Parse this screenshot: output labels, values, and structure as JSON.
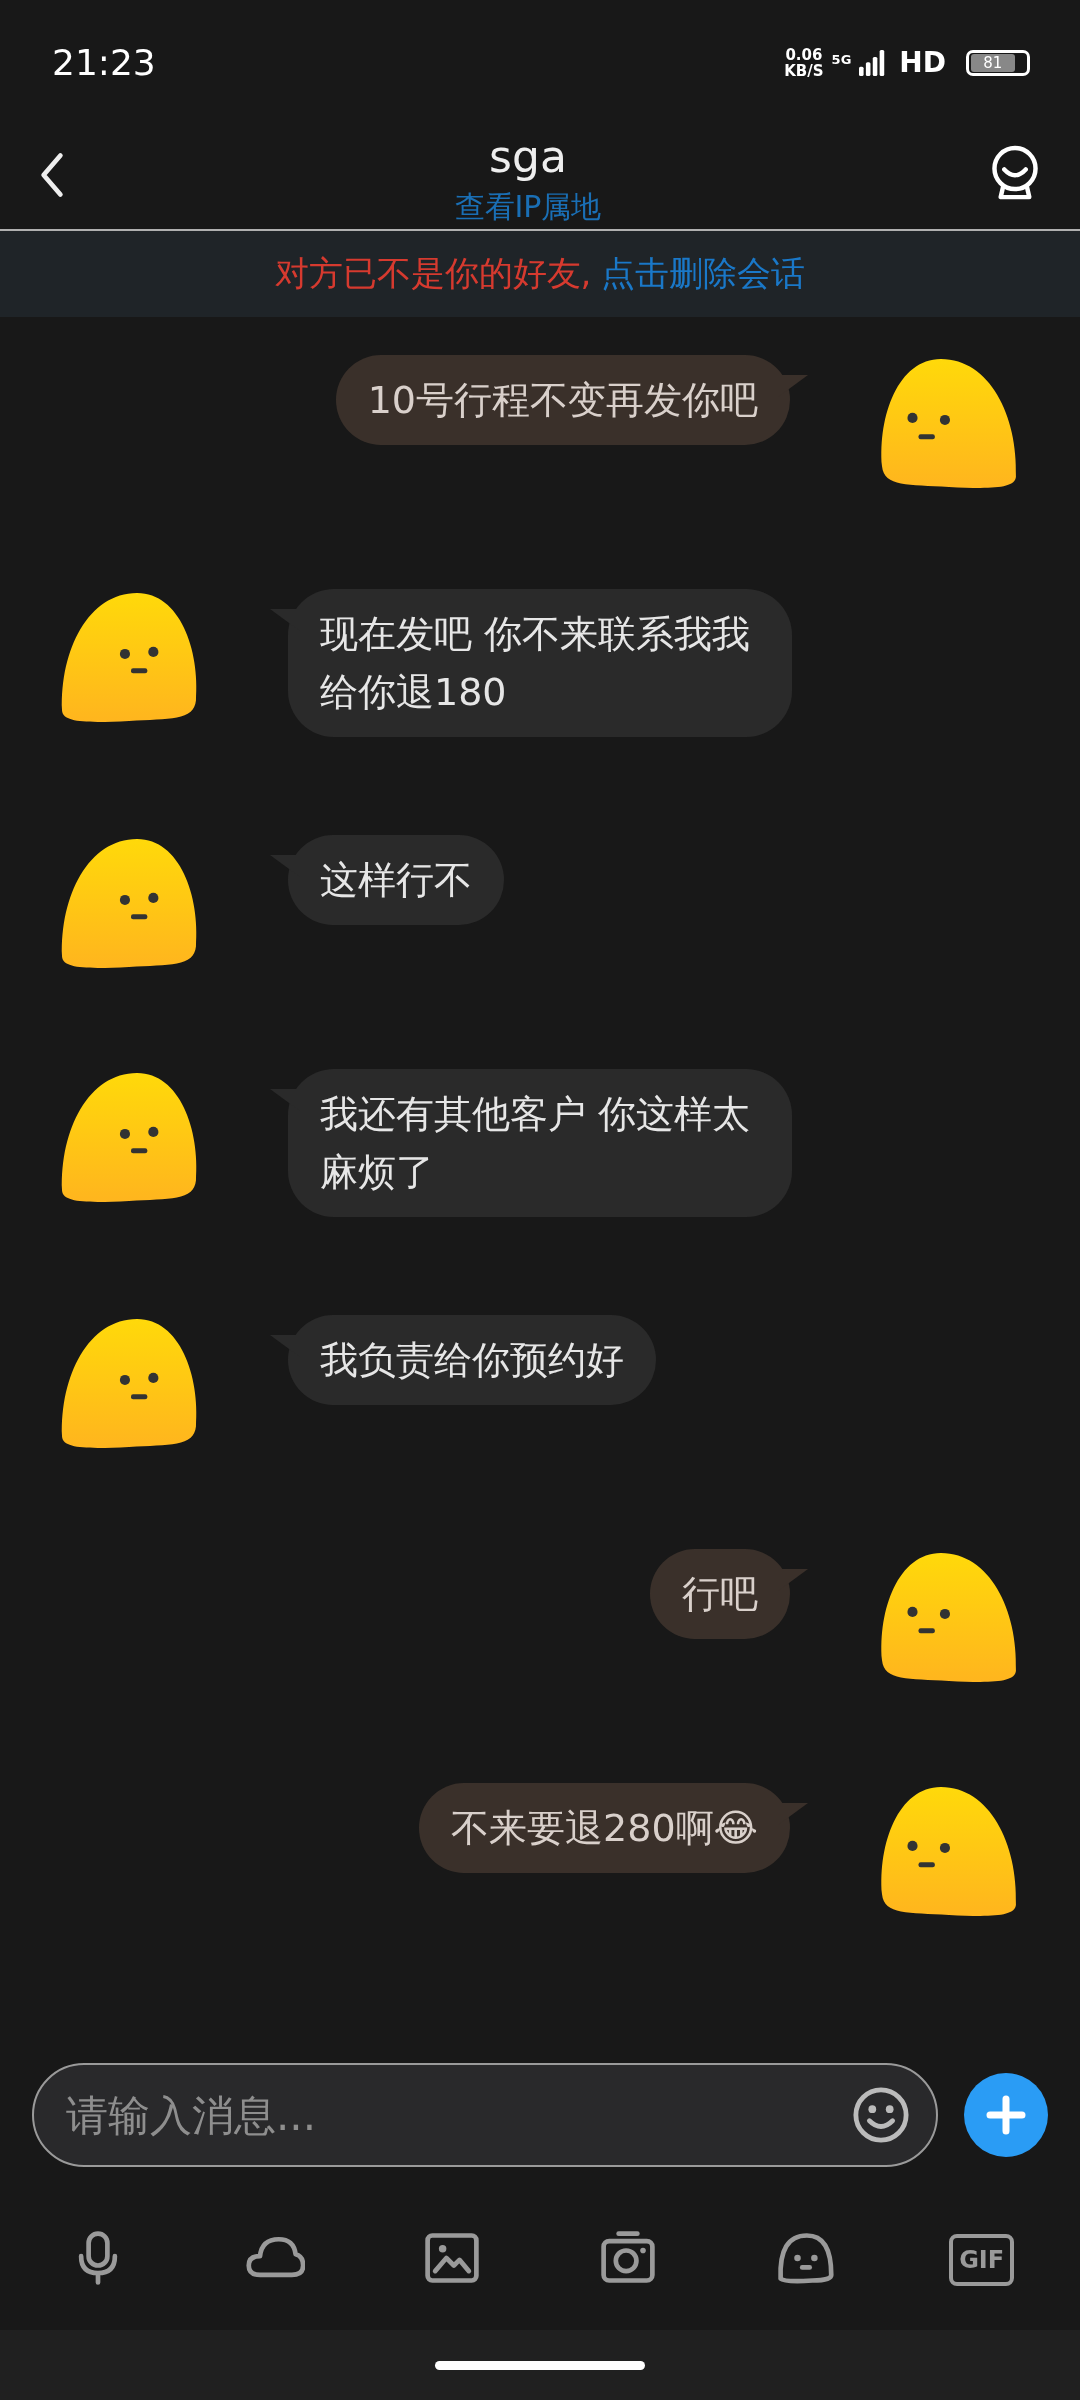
{
  "status_bar": {
    "time": "21:23",
    "net_speed": [
      "0.06",
      "KB/S"
    ],
    "network": "5G",
    "hd": "HD",
    "battery": "81"
  },
  "header": {
    "title": "sga",
    "subtitle": "查看IP属地"
  },
  "banner": {
    "notice": "对方已不是你的好友,",
    "action": "点击删除会话"
  },
  "messages": [
    {
      "kind": "outgoing",
      "text": "10号行程不变再发你吧"
    },
    {
      "kind": "incoming",
      "text": "现在发吧 你不来联系我我给你退180"
    },
    {
      "kind": "incoming",
      "text": "这样行不"
    },
    {
      "kind": "incoming",
      "text": "我还有其他客户 你这样太麻烦了"
    },
    {
      "kind": "incoming",
      "text": "我负责给你预约好"
    },
    {
      "kind": "outgoing",
      "text": "行吧"
    },
    {
      "kind": "outgoing",
      "text": "不来要退280啊😂"
    }
  ],
  "composer": {
    "placeholder": "请输入消息..."
  },
  "toolbar": [
    {
      "kind": "mic"
    },
    {
      "kind": "cloud"
    },
    {
      "kind": "image"
    },
    {
      "kind": "camera"
    },
    {
      "kind": "ghost"
    },
    {
      "kind": "gif",
      "label": "GIF"
    }
  ]
}
